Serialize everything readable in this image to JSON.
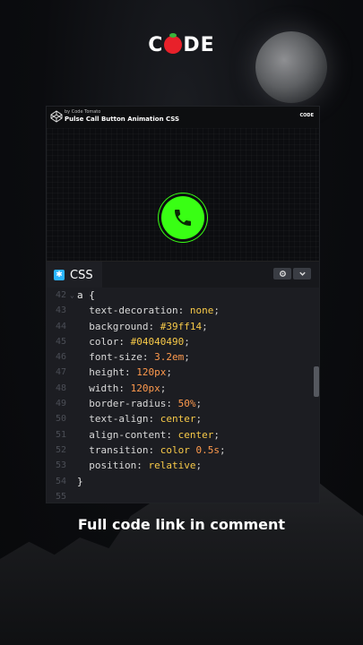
{
  "brand": {
    "logo_left": "C",
    "logo_right": "DE"
  },
  "pen": {
    "author": "by Code Tomato",
    "title": "Pulse Call Button Animation CSS",
    "mini_logo": "CODE"
  },
  "colors": {
    "accent": "#39ff14",
    "tab_icon": "#2ab5ff",
    "value": "#f7c948",
    "number": "#ff9a4d"
  },
  "editor": {
    "tab_label": "CSS",
    "tab_icon": "asterisk-icon",
    "lines": [
      {
        "n": "42",
        "fold": "v",
        "parts": [
          {
            "t": "a {",
            "c": "sel"
          }
        ]
      },
      {
        "n": "43",
        "fold": "",
        "parts": [
          {
            "t": "  text-decoration: ",
            "c": "prop"
          },
          {
            "t": "none",
            "c": "val"
          },
          {
            "t": ";",
            "c": "punc"
          }
        ]
      },
      {
        "n": "44",
        "fold": "",
        "parts": [
          {
            "t": "  background: ",
            "c": "prop"
          },
          {
            "t": "#39ff14",
            "c": "val"
          },
          {
            "t": ";",
            "c": "punc"
          }
        ]
      },
      {
        "n": "45",
        "fold": "",
        "parts": [
          {
            "t": "  color: ",
            "c": "prop"
          },
          {
            "t": "#04040490",
            "c": "val"
          },
          {
            "t": ";",
            "c": "punc"
          }
        ]
      },
      {
        "n": "46",
        "fold": "",
        "parts": [
          {
            "t": "  font-size: ",
            "c": "prop"
          },
          {
            "t": "3.2em",
            "c": "num"
          },
          {
            "t": ";",
            "c": "punc"
          }
        ]
      },
      {
        "n": "47",
        "fold": "",
        "parts": [
          {
            "t": "  height: ",
            "c": "prop"
          },
          {
            "t": "120px",
            "c": "num"
          },
          {
            "t": ";",
            "c": "punc"
          }
        ]
      },
      {
        "n": "48",
        "fold": "",
        "parts": [
          {
            "t": "  width: ",
            "c": "prop"
          },
          {
            "t": "120px",
            "c": "num"
          },
          {
            "t": ";",
            "c": "punc"
          }
        ]
      },
      {
        "n": "49",
        "fold": "",
        "parts": [
          {
            "t": "  border-radius: ",
            "c": "prop"
          },
          {
            "t": "50%",
            "c": "num"
          },
          {
            "t": ";",
            "c": "punc"
          }
        ]
      },
      {
        "n": "50",
        "fold": "",
        "parts": [
          {
            "t": "  text-align: ",
            "c": "prop"
          },
          {
            "t": "center",
            "c": "val"
          },
          {
            "t": ";",
            "c": "punc"
          }
        ]
      },
      {
        "n": "51",
        "fold": "",
        "parts": [
          {
            "t": "  align-content: ",
            "c": "prop"
          },
          {
            "t": "center",
            "c": "val"
          },
          {
            "t": ";",
            "c": "punc"
          }
        ]
      },
      {
        "n": "52",
        "fold": "",
        "parts": [
          {
            "t": "  transition: ",
            "c": "prop"
          },
          {
            "t": "color ",
            "c": "val"
          },
          {
            "t": "0.5s",
            "c": "num"
          },
          {
            "t": ";",
            "c": "punc"
          }
        ]
      },
      {
        "n": "53",
        "fold": "",
        "parts": [
          {
            "t": "  position: ",
            "c": "prop"
          },
          {
            "t": "relative",
            "c": "val"
          },
          {
            "t": ";",
            "c": "punc"
          }
        ]
      },
      {
        "n": "54",
        "fold": "",
        "parts": [
          {
            "t": "}",
            "c": "sel"
          }
        ]
      },
      {
        "n": "55",
        "fold": "",
        "parts": []
      }
    ]
  },
  "caption": "Full code link in comment"
}
